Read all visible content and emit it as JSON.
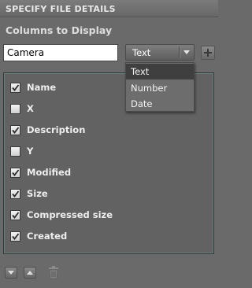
{
  "header": {
    "title": "SPECIFY FILE DETAILS"
  },
  "section": {
    "title": "Columns to Display"
  },
  "column_input": {
    "value": "Camera"
  },
  "type_select": {
    "selected": "Text",
    "options": [
      "Text",
      "Number",
      "Date"
    ]
  },
  "columns": [
    {
      "label": "Name",
      "checked": true
    },
    {
      "label": "X",
      "checked": false
    },
    {
      "label": "Description",
      "checked": true
    },
    {
      "label": "Y",
      "checked": false
    },
    {
      "label": "Modified",
      "checked": true
    },
    {
      "label": "Size",
      "checked": true
    },
    {
      "label": "Compressed size",
      "checked": true
    },
    {
      "label": "Created",
      "checked": true
    }
  ],
  "icons": {
    "add": "plus-icon",
    "move_down": "arrow-down-icon",
    "move_up": "arrow-up-icon",
    "delete": "trash-icon"
  }
}
